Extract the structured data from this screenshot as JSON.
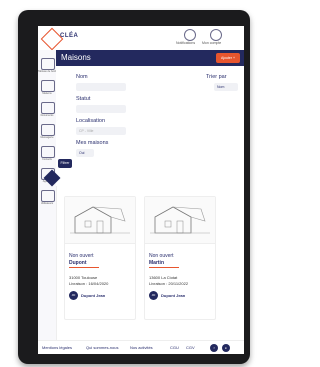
{
  "app": {
    "logo": "CLÉA"
  },
  "topbar": {
    "notifications_label": "Notifications",
    "account_label": "Mon compte"
  },
  "sidebar": {
    "items": [
      {
        "label": "Tableau de bord"
      },
      {
        "label": "Maisons"
      },
      {
        "label": "Documents"
      },
      {
        "label": "Messagerie"
      },
      {
        "label": "Contacts"
      },
      {
        "label": "Agenda"
      },
      {
        "label": "Utilisateurs"
      }
    ]
  },
  "header": {
    "title": "Maisons",
    "add_button": "Ajouter +"
  },
  "filters": {
    "nom_label": "Nom",
    "statut_label": "Statut",
    "localisation_label": "Localisation",
    "localisation_placeholder": "CP - Ville",
    "mes_maisons_label": "Mes maisons",
    "mes_maisons_value": "Oui",
    "trier_label": "Trier par",
    "trier_value": "Nom",
    "filter_button": "Filtrer"
  },
  "cards": [
    {
      "status": "Non ouvert",
      "name": "Dupont",
      "city": "31000 Toulouse",
      "date": "Livraison : 16/04/2020",
      "avatar": "JD",
      "person": "Dupont Jean"
    },
    {
      "status": "Non ouvert",
      "name": "Martin",
      "city": "13600 La Ciotat",
      "date": "Livraison : 20/11/2022",
      "avatar": "JD",
      "person": "Dupont Jean"
    }
  ],
  "footer": {
    "links": [
      "Mentions légales",
      "Qui sommes-nous",
      "Nos activités",
      "CGU",
      "CGV"
    ],
    "social": [
      "f",
      "in"
    ]
  }
}
